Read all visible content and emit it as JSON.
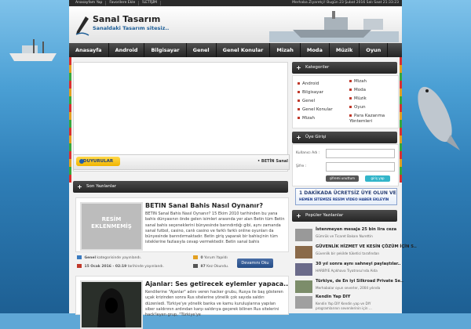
{
  "topbar": {
    "links": [
      "Anasayfam Yap",
      "Favorilere Ekle",
      "İLETİŞİM"
    ],
    "welcome": "Merhaba Ziyaretçi! Bugün 23 Şubat 2016 Salı Saat 21:33:23"
  },
  "header": {
    "title": "Sanal Tasarım",
    "subtitle": "Sanaldaki Tasarım sitesiz.."
  },
  "nav": [
    "Anasayfa",
    "Android",
    "Bilgisayar",
    "Genel",
    "Genel Konular",
    "Mizah",
    "Moda",
    "Müzik",
    "Oyun"
  ],
  "announcement": {
    "badge": "DUYURULAR",
    "text": "• BETİN Sanal"
  },
  "sections": {
    "recent": "Son Yazılanlar",
    "categories": "Kategoriler",
    "login": "Üye Girişi",
    "popular": "Popüler Yazılanlar"
  },
  "posts": [
    {
      "title": "BETIN Sanal Bahis Nasıl Oynanır?",
      "placeholder": "RESİM EKLENMEMİŞ",
      "body": "BETIN Sanal Bahis Nasıl Oynanır? 15 Ekim 2010 tarihinden bu yana bahis dünyasının önde gelen isimleri arasında yer alan Betin tüm Betin sanal bahis seçeneklerini bünyesinde barındırdığı gibi, aynı zamanda sanal futbol, casino, canlı casino ve farklı farklı online oyunları da bünyesinde barındırmaktadır.  Betin giriş yaparak bir bahisçinin tüm isteklerine fazlasıyla cevap vermektedir. Betin sanal bahis",
      "category": "Genel",
      "category_suffix": "kategorisinde yayınlandı.",
      "comments": "0",
      "comments_label": "Yorum Yapıldı",
      "date": "15 Ocak 2016 - 02:19",
      "date_suffix": "tarihinde yayınlandı.",
      "reads": "87",
      "reads_label": "Kez Okundu.",
      "readmore": "Devamını Oku"
    },
    {
      "title": "Ajanlar: Ses getirecek eylemler yapaca..",
      "body": "Kendilerine \"Ajanlar\" adını veren hacker grubu, Rusya ile baş gösteren uçak krizinden sonra Rus sitelerine yönelik çok sayıda saldırı düzenledi. Türkiye'ye yönelik banka ve kamu kuruluşlarına yapılan siber saldırının ardından karşı saldırıya geçerek bilinen Rus sitelerini hack'leyen grup, \"Türkiye'ye"
    }
  ],
  "categories": {
    "left": [
      "Android",
      "Bilgisayar",
      "Genel",
      "Genel Konular",
      "Mizah"
    ],
    "right": [
      "Mizah",
      "Moda",
      "Müzik",
      "Oyun",
      "Para Kazanma Yöntemleri"
    ]
  },
  "login": {
    "username_label": "Kullanıcı Adı :",
    "password_label": "Şifre :",
    "forgot": "şifremi unuttum",
    "submit": "giriş yap"
  },
  "banner": {
    "line1": "1 DAKİKADA ÜCRETSİZ ÜYE OLUN VE",
    "line2": "HEMEN SİTEMİZE RESİM VİDEO HABER EKLEYİN"
  },
  "popular": [
    {
      "title": "İstenmeyen mesaja 25 bin lira ceza",
      "sub": "Gümrük ve Ticaret Bakanı Nurettin"
    },
    {
      "title": "GÜVENLİK HİZMET VE KESİN ÇÖZÜM İÇİN S..",
      "sub": "Güvenlik bir şekilde tüketici tarafından"
    },
    {
      "title": "30 yıl sonra aynı sahneyi paylaştılar..",
      "sub": "HARBİYE Açıkhava Tiyatrosu'nda Aida"
    },
    {
      "title": "Türkiye, de En iyi Silkroad Private Se..",
      "sub": "Merhabalar oyun severler, 2004 yılında"
    },
    {
      "title": "Kendin Yap DIY",
      "sub": "Kendin Yap DIY Kendin yap ve DIY"
    },
    {
      "title": "",
      "sub": "programlarının sevenlerinin için ..."
    }
  ]
}
